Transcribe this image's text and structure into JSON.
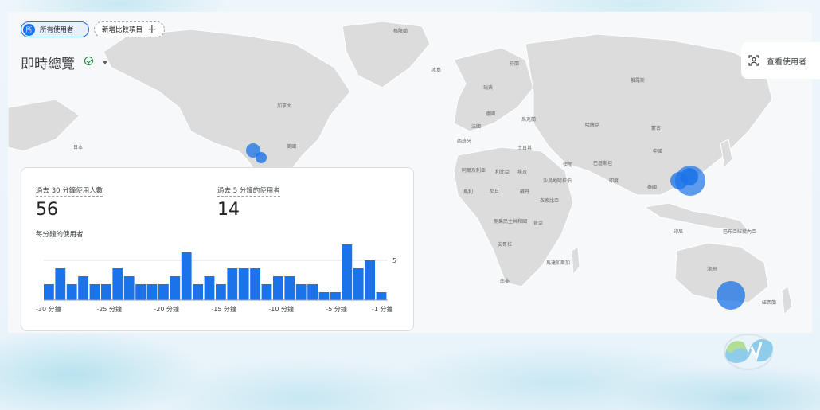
{
  "filters": {
    "users_chip": {
      "avatar": "所",
      "label": "所有使用者"
    },
    "add_chip": {
      "label": "新增比較項目",
      "icon": "plus-icon"
    }
  },
  "header": {
    "title": "即時總覽",
    "status_icon": "check-circle-icon",
    "dropdown_icon": "caret-down-icon"
  },
  "view_users": {
    "label": "查看使用者",
    "icon": "user-scan-icon"
  },
  "map": {
    "labels": [
      {
        "text": "格陵蘭"
      },
      {
        "text": "冰島"
      },
      {
        "text": "加拿大"
      },
      {
        "text": "美國"
      },
      {
        "text": "日本"
      },
      {
        "text": "中國"
      },
      {
        "text": "俄羅斯"
      },
      {
        "text": "哈薩克"
      },
      {
        "text": "蒙古"
      },
      {
        "text": "印度"
      },
      {
        "text": "伊朗"
      },
      {
        "text": "土耳其"
      },
      {
        "text": "沙烏地阿拉伯"
      },
      {
        "text": "埃及"
      },
      {
        "text": "利比亞"
      },
      {
        "text": "阿爾及利亞"
      },
      {
        "text": "馬利"
      },
      {
        "text": "尼日"
      },
      {
        "text": "蘇丹"
      },
      {
        "text": "衣索比亞"
      },
      {
        "text": "剛果民主共和國"
      },
      {
        "text": "肯亞"
      },
      {
        "text": "安哥拉"
      },
      {
        "text": "南非"
      },
      {
        "text": "馬達加斯加"
      },
      {
        "text": "澳洲"
      },
      {
        "text": "印尼"
      },
      {
        "text": "巴布亞紐幾內亞"
      },
      {
        "text": "紐西蘭"
      },
      {
        "text": "瑞典"
      },
      {
        "text": "芬蘭"
      },
      {
        "text": "德國"
      },
      {
        "text": "法國"
      },
      {
        "text": "西班牙"
      },
      {
        "text": "烏克蘭"
      },
      {
        "text": "巴基斯坦"
      },
      {
        "text": "泰國"
      }
    ],
    "bubble_color": "#1a73e8"
  },
  "card": {
    "metric_30": {
      "label": "過去 30 分鐘使用人數",
      "value": "56"
    },
    "metric_5": {
      "label": "過去 5 分鐘的使用者",
      "value": "14"
    },
    "per_minute_label": "每分鐘的使用者"
  },
  "chart_data": {
    "type": "bar",
    "title": "每分鐘的使用者",
    "x_tick_labels": [
      "-30 分鐘",
      "-25 分鐘",
      "-20 分鐘",
      "-15 分鐘",
      "-10 分鐘",
      "-5 分鐘",
      "-1 分鐘"
    ],
    "y_tick_labels": [
      "5"
    ],
    "ylim": [
      0,
      7
    ],
    "values": [
      2,
      4,
      2,
      3,
      2,
      2,
      4,
      3,
      2,
      2,
      2,
      3,
      6,
      2,
      3,
      2,
      4,
      4,
      4,
      2,
      3,
      3,
      2,
      2,
      1,
      1,
      7,
      4,
      5,
      1
    ],
    "bar_color": "#1a73e8",
    "grid": true
  }
}
